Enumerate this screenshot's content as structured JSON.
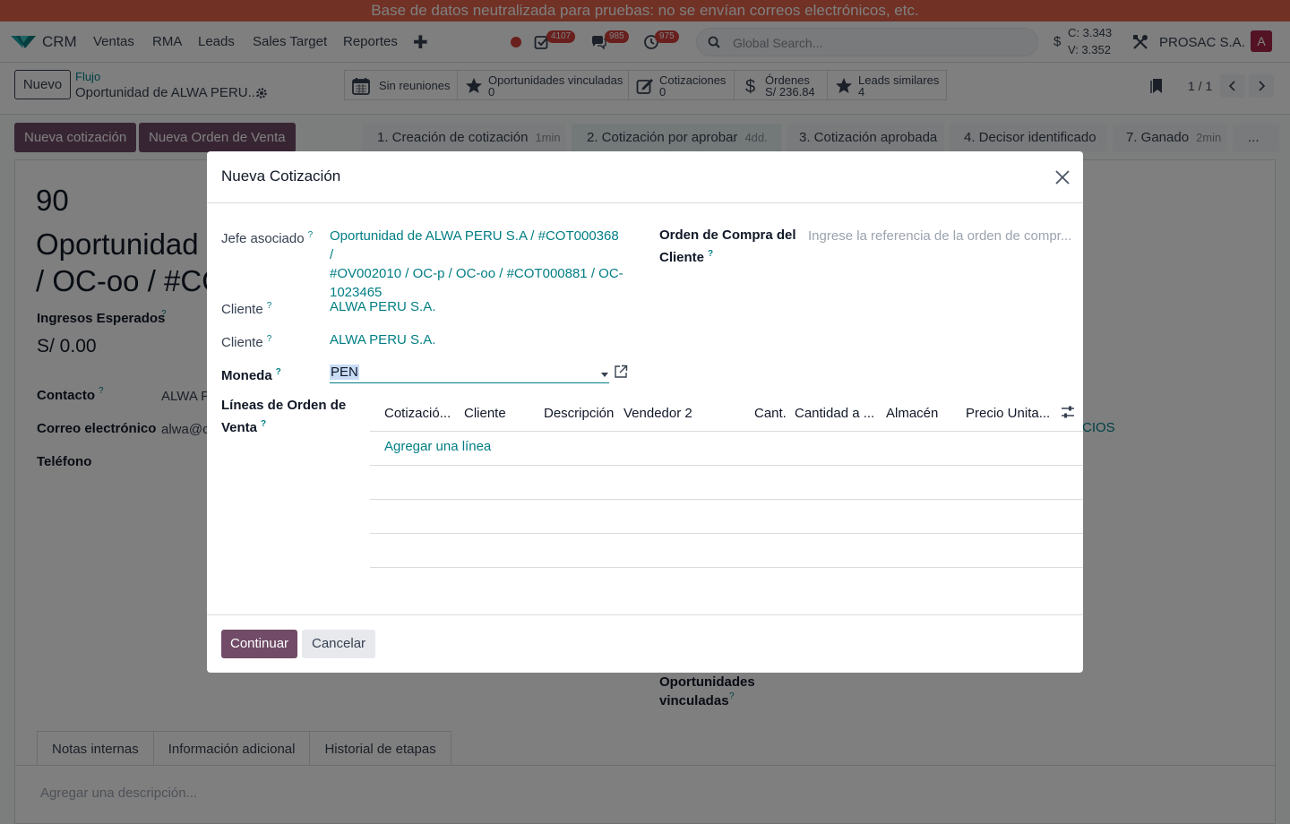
{
  "banner": {
    "text": "Base de datos neutralizada para pruebas: no se envían correos electrónicos, etc."
  },
  "navbar": {
    "app_name": "CRM",
    "menus": [
      "Ventas",
      "RMA",
      "Leads",
      "Sales Target",
      "Reportes"
    ],
    "plus_label": "✚",
    "activity_count": "4107",
    "messages_count": "985",
    "clock_count": "975",
    "search_placeholder": "Global Search...",
    "currency_symbol": "$",
    "rate_c": "C: 3.343",
    "rate_v": "V: 3.352",
    "company": "PROSAC S.A.",
    "avatar_letter": "A"
  },
  "control": {
    "new_label": "Nuevo",
    "breadcrumb_link": "Flujo",
    "record_title": "Oportunidad de ALWA PERU...",
    "smart_buttons": [
      {
        "label": "Sin reuniones"
      },
      {
        "label": "Oportunidades vinculadas",
        "value": "0"
      },
      {
        "label": "Cotizaciones",
        "value": "0"
      },
      {
        "label": "Órdenes",
        "value": "S/ 236.84"
      },
      {
        "label": "Leads similares",
        "value": "4"
      }
    ],
    "pager": "1 / 1"
  },
  "statusbar": {
    "new_quote": "Nueva cotización",
    "new_order": "Nueva Orden de Venta",
    "stages": [
      {
        "label": "1. Creación de cotización",
        "duration": "1min"
      },
      {
        "label": "2. Cotización por aprobar",
        "duration": "4dd."
      },
      {
        "label": "3. Cotización aprobada"
      },
      {
        "label": "4. Decisor identificado"
      },
      {
        "label": "7. Ganado",
        "duration": "2min"
      },
      {
        "label": "..."
      }
    ]
  },
  "sheet": {
    "number": "90",
    "title_line1": "Oportunidad",
    "title_line2": "/ OC-oo / #CO",
    "revenue_label": "Ingresos Esperados",
    "revenue_value": "S/ 0.00",
    "contact_label": "Contacto",
    "contact_value": "ALWA P",
    "email_label": "Correo electrónico",
    "email_value": "alwa@c",
    "phone_label": "Teléfono",
    "right_link_fragment": "CIOS",
    "linked_label_1": "Oportunidades",
    "linked_label_2": "vinculadas",
    "tabs": [
      "Notas internas",
      "Información adicional",
      "Historial de etapas"
    ],
    "description_placeholder": "Agregar una descripción..."
  },
  "modal": {
    "title": "Nueva Cotización",
    "parent_label": "Jefe asociado",
    "parent_value_lines": [
      "Oportunidad de ALWA PERU S.A / #COT000368 /",
      "#OV002010 / OC-p / OC-oo / #COT000881 / OC-",
      "1023465"
    ],
    "po_label_1": "Orden de Compra del",
    "po_label_2": "Cliente",
    "po_placeholder": "Ingrese la referencia de la orden de compr...",
    "client_label": "Cliente",
    "client_value": "ALWA PERU S.A.",
    "client2_label": "Cliente",
    "client2_value": "ALWA PERU S.A.",
    "currency_label": "Moneda",
    "currency_value": "PEN",
    "lines_label_1": "Líneas de Orden de",
    "lines_label_2": "Venta",
    "columns": [
      "Cotizació...",
      "Cliente",
      "Descripción",
      "Vendedor 2",
      "Cant.",
      "Cantidad a ...",
      "Almacén",
      "Precio Unita..."
    ],
    "add_line": "Agregar una línea",
    "continue_label": "Continuar",
    "cancel_label": "Cancelar"
  },
  "colors": {
    "primary": "#714b67",
    "link": "#017e84",
    "banner": "#e3624a",
    "badge": "#d23f3a"
  }
}
